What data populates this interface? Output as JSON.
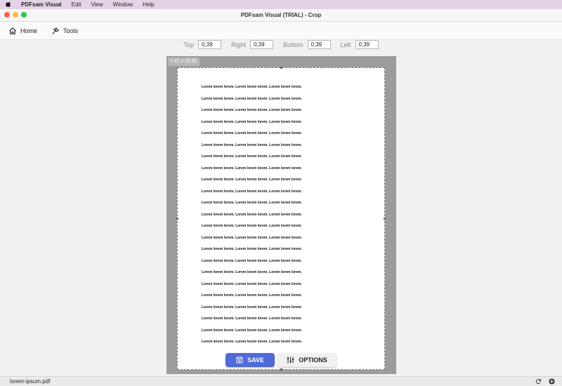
{
  "menubar": {
    "app_name": "PDFsam Visual",
    "items": [
      "Edit",
      "View",
      "Window",
      "Help"
    ]
  },
  "window": {
    "title": "PDFsam Visual (TRIAL) - Crop",
    "colors": {
      "close": "#ff5f57",
      "minimize": "#febc2e",
      "zoom": "#28c840"
    }
  },
  "toolbar": {
    "home_label": "Home",
    "tools_label": "Tools"
  },
  "crop": {
    "top_label": "Top",
    "top_value": "0,39",
    "right_label": "Right",
    "right_value": "0,39",
    "bottom_label": "Bottom",
    "bottom_value": "0,39",
    "left_label": "Left",
    "left_value": "0,39"
  },
  "page": {
    "size_label": "7.47 x 10.91",
    "lines": [
      "Lorem lorem lorem. Lorem lorem lorem. Lorem lorem lorem.",
      "Lorem lorem lorem. Lorem lorem lorem. Lorem lorem lorem.",
      "Lorem lorem lorem. Lorem lorem lorem. Lorem lorem lorem.",
      "Lorem lorem lorem. Lorem lorem lorem. Lorem lorem lorem.",
      "Lorem lorem lorem. Lorem lorem lorem. Lorem lorem lorem.",
      "Lorem lorem lorem. Lorem lorem lorem. Lorem lorem lorem.",
      "Lorem lorem lorem. Lorem lorem lorem. Lorem lorem lorem.",
      "Lorem lorem lorem. Lorem lorem lorem. Lorem lorem lorem.",
      "Lorem lorem lorem. Lorem lorem lorem. Lorem lorem lorem.",
      "Lorem lorem lorem. Lorem lorem lorem. Lorem lorem lorem.",
      "Lorem lorem lorem. Lorem lorem lorem. Lorem lorem lorem.",
      "Lorem lorem lorem. Lorem lorem lorem. Lorem lorem lorem.",
      "Lorem lorem lorem. Lorem lorem lorem. Lorem lorem lorem.",
      "Lorem lorem lorem. Lorem lorem lorem. Lorem lorem lorem.",
      "Lorem lorem lorem. Lorem lorem lorem. Lorem lorem lorem.",
      "Lorem lorem lorem. Lorem lorem lorem. Lorem lorem lorem.",
      "Lorem lorem lorem. Lorem lorem lorem. Lorem lorem lorem.",
      "Lorem lorem lorem. Lorem lorem lorem. Lorem lorem lorem.",
      "Lorem lorem lorem. Lorem lorem lorem. Lorem lorem lorem.",
      "Lorem lorem lorem. Lorem lorem lorem. Lorem lorem lorem.",
      "Lorem lorem lorem. Lorem lorem lorem. Lorem lorem lorem.",
      "Lorem lorem lorem. Lorem lorem lorem. Lorem lorem lorem.",
      "Lorem lorem lorem. Lorem lorem lorem. Lorem lorem lorem."
    ]
  },
  "actions": {
    "save_label": "SAVE",
    "options_label": "OPTIONS",
    "save_color": "#4f6ad9"
  },
  "status": {
    "filename": "lorem-ipsum.pdf",
    "icons": [
      "refresh-icon",
      "add-circle-icon"
    ]
  }
}
